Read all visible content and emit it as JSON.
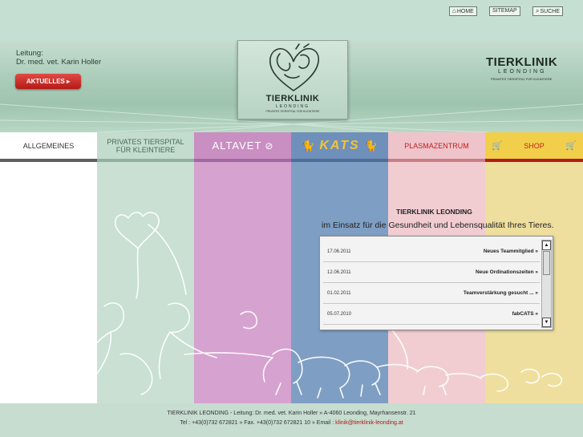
{
  "top_links": [
    {
      "label": "HOME",
      "icon": "home-icon"
    },
    {
      "label": "SITEMAP"
    },
    {
      "label": "SUCHE",
      "icon": "search-icon"
    }
  ],
  "header": {
    "leitung_label": "Leitung:",
    "leitung_name": "Dr. med. vet. Karin Holler",
    "aktuelles_button": "AKTUELLES",
    "logo_title": "TIERKLINIK",
    "logo_subtitle": "LEONDING",
    "logo_tagline": "PRIVATES TIERSPITAL FÜR KLEINTIERE",
    "brand_title": "TIERKLINIK",
    "brand_subtitle": "LEONDING",
    "brand_tagline": "PRIVATES TIERSPITAL FÜR KLEINTIERE"
  },
  "nav": [
    {
      "line1": "ALLGEMEINES",
      "line2": ""
    },
    {
      "line1": "PRIVATES TIERSPITAL",
      "line2": "FÜR KLEINTIERE"
    },
    {
      "line1": "ALTAVET",
      "line2": ""
    },
    {
      "line1": "KATS",
      "line2": ""
    },
    {
      "line1": "PLASMAZENTRUM",
      "line2": ""
    },
    {
      "line1": "SHOP",
      "line2": ""
    }
  ],
  "colors": {
    "col_white": "#ffffff",
    "col_green": "#c9e0d3",
    "col_pink": "#d6a2cf",
    "col_blue": "#7f9ec4",
    "col_rose": "#f1cdd2",
    "col_yellow": "#efdf9e",
    "accent_red": "#c2221e"
  },
  "main": {
    "headline": "TIERKLINIK LEONDING",
    "tagline": "im Einsatz für die Gesundheit und Lebensqualität Ihres Tieres."
  },
  "news": [
    {
      "date": "17.06.2011",
      "title": "Neues Teammitglied »"
    },
    {
      "date": "12.06.2011",
      "title": "Neue Ordinationszeiten »"
    },
    {
      "date": "01.02.2011",
      "title": "Teamverstärkung gesucht ... »"
    },
    {
      "date": "05.07.2010",
      "title": "fabCATS »"
    }
  ],
  "footer": {
    "line1": "TIERKLINIK LEONDING - Leitung: Dr. med. vet. Karin Holler » A-4060 Leonding, Mayrhansenstr. 21",
    "line2": "Tel : +43(0)732 672821 » Fax. +43(0)732 672821 10 » Email :",
    "email": "klinik@tierklinik-leonding.at"
  }
}
